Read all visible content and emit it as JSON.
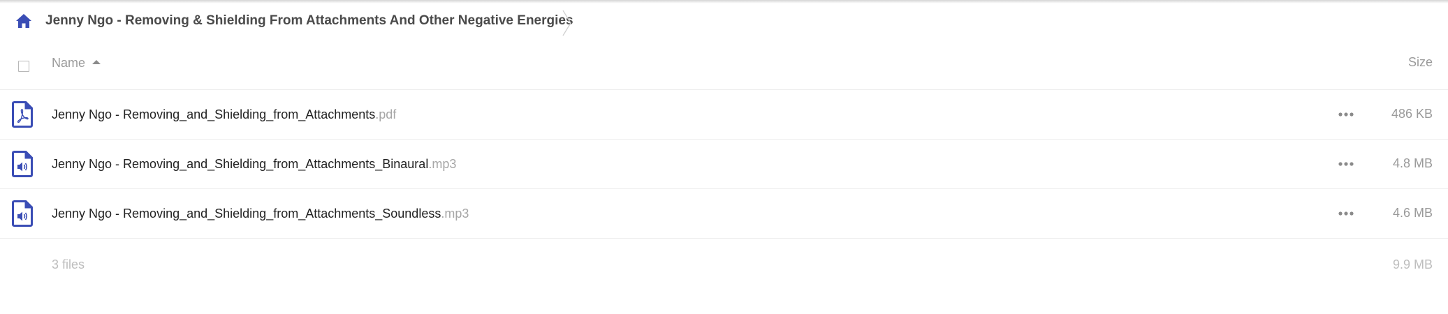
{
  "breadcrumb": {
    "home_icon": "home-icon",
    "current_folder": "Jenny Ngo - Removing & Shielding From Attachments And Other Negative Energies"
  },
  "table_header": {
    "name_label": "Name",
    "sort_icon": "sort-ascending-icon",
    "size_label": "Size"
  },
  "files": [
    {
      "basename": "Jenny Ngo - Removing_and_Shielding_from_Attachments",
      "extension": ".pdf",
      "size": "486 KB",
      "icon": "pdf-file-icon"
    },
    {
      "basename": "Jenny Ngo - Removing_and_Shielding_from_Attachments_Binaural",
      "extension": ".mp3",
      "size": "4.8 MB",
      "icon": "audio-file-icon"
    },
    {
      "basename": "Jenny Ngo - Removing_and_Shielding_from_Attachments_Soundless",
      "extension": ".mp3",
      "size": "4.6 MB",
      "icon": "audio-file-icon"
    }
  ],
  "summary": {
    "count": "3 files",
    "total_size": "9.9 MB"
  },
  "colors": {
    "accent": "#3a4db5",
    "text": "#222222",
    "muted": "#9a9a9a",
    "divider": "#ededed"
  }
}
